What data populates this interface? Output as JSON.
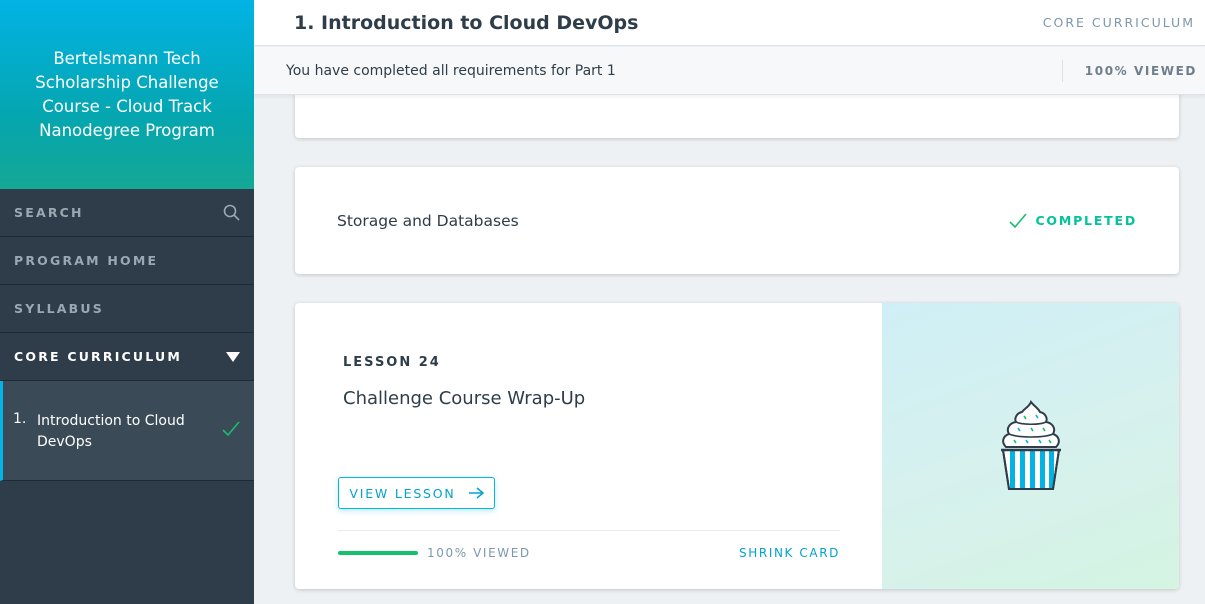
{
  "sidebar": {
    "program_title": "Bertelsmann Tech Scholarship Challenge Course - Cloud Track Nanodegree Program",
    "search_label": "SEARCH",
    "program_home_label": "PROGRAM HOME",
    "syllabus_label": "SYLLABUS",
    "core_curriculum_label": "CORE CURRICULUM",
    "lesson": {
      "number": "1.",
      "name": "Introduction to Cloud DevOps"
    }
  },
  "header": {
    "title": "1. Introduction to Cloud DevOps",
    "section": "CORE CURRICULUM"
  },
  "notice": {
    "text": "You have completed all requirements for Part 1",
    "status": "100% VIEWED"
  },
  "cards": {
    "storage": {
      "title": "Storage and Databases",
      "status": "COMPLETED"
    },
    "lesson": {
      "kicker": "LESSON 24",
      "title": "Challenge Course Wrap-Up",
      "button": "VIEW LESSON",
      "progress_label": "100% VIEWED",
      "progress_fraction": 1.0,
      "shrink": "SHRINK CARD",
      "art_icon": "cupcake-icon"
    }
  },
  "colors": {
    "accent": "#02b3e4",
    "success": "#15c26b",
    "sidebar_bg": "#2e3d49"
  }
}
